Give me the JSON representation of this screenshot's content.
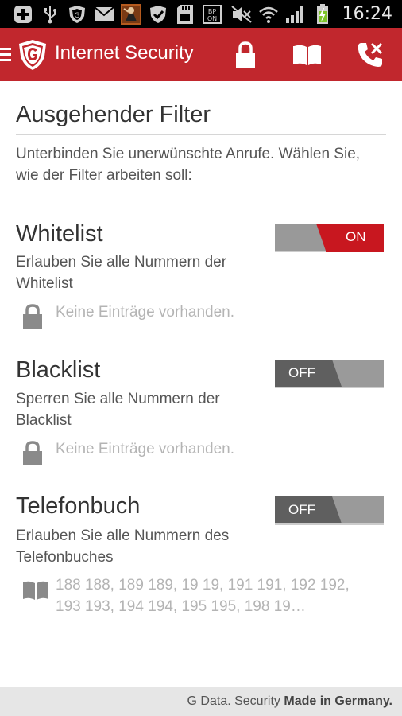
{
  "status_bar": {
    "time": "16:24",
    "icons_left": [
      "add-icon",
      "usb-icon",
      "shield-icon",
      "mail-icon",
      "app-icon",
      "shield-check-icon",
      "sd-card-icon",
      "bp-on-icon"
    ],
    "icons_right": [
      "mute-icon",
      "wifi-icon",
      "signal-icon",
      "battery-charging-icon"
    ]
  },
  "app_bar": {
    "title": "Internet Security",
    "color": "#c1272d",
    "actions": [
      "lock-icon",
      "book-icon",
      "phone-blocked-icon"
    ]
  },
  "page": {
    "title": "Ausgehender Filter",
    "intro": "Unterbinden Sie unerwünschte Anrufe. Wählen Sie, wie der Filter arbeiten soll:"
  },
  "filters": [
    {
      "name": "Whitelist",
      "description": "Erlauben Sie alle Nummern der Whitelist",
      "toggle": "ON",
      "entries": "Keine Einträge vorhanden.",
      "entry_icon": "lock-icon"
    },
    {
      "name": "Blacklist",
      "description": "Sperren Sie alle Nummern der Blacklist",
      "toggle": "OFF",
      "entries": "Keine Einträge vorhanden.",
      "entry_icon": "lock-icon"
    },
    {
      "name": "Telefonbuch",
      "description": "Erlauben Sie alle Nummern des Telefonbuches",
      "toggle": "OFF",
      "entries": "188 188, 189 189, 19 19, 191 191, 192 192, 193 193, 194 194, 195 195, 198 19…",
      "entry_icon": "book-icon"
    }
  ],
  "footer": {
    "brand": "G Data. Security",
    "tagline": "Made in Germany."
  }
}
